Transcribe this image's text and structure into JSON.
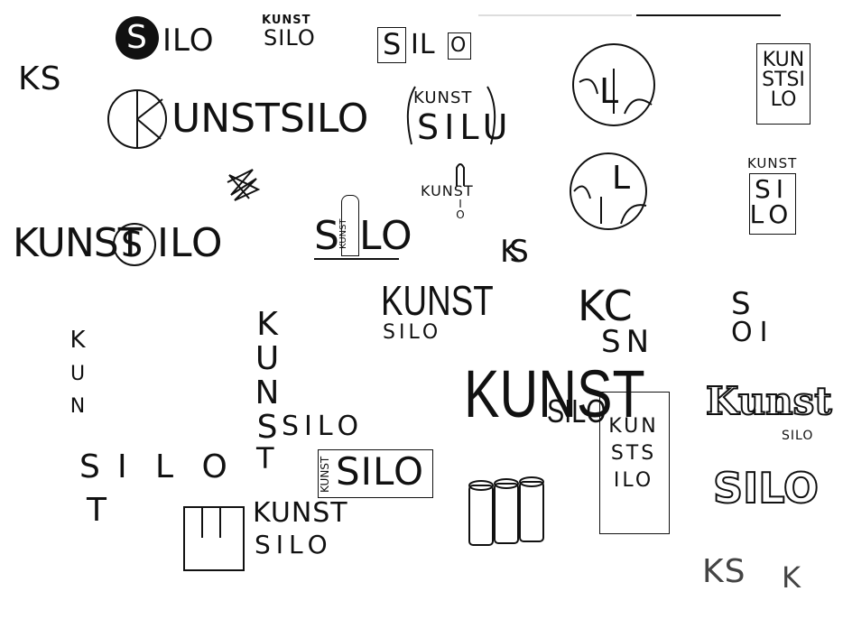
{
  "sketches": {
    "ks_top_left": "KS",
    "silo_black_circle": {
      "letter": "S",
      "rest": "ILO"
    },
    "kunst_silo_small": {
      "top": "KUNST",
      "bottom": "SILO"
    },
    "silo_boxes": {
      "s": "S",
      "il": "IL",
      "o": "O"
    },
    "circle_silo_1": {
      "letters": [
        "S",
        "I",
        "L",
        "O"
      ]
    },
    "kunstsilo_vertical_box_1": [
      "KUN",
      "STSI",
      "LO"
    ],
    "k_circle_kunstsilo": {
      "letter": "K",
      "rest": "UNSTSILO"
    },
    "kunst_silo_arc": {
      "top": "KUNST",
      "bottom": "SILU"
    },
    "kunst_small_stacked": {
      "top": "KUNST",
      "bottom": [
        "I",
        "O"
      ]
    },
    "circle_silo_2": {
      "letters": [
        "S",
        "I",
        "L",
        "O"
      ]
    },
    "kunst_silo_box_small": {
      "top": "KUNST",
      "rows": [
        "SI",
        "LO"
      ]
    },
    "kunstsilo_circle_s": {
      "left": "KUNST",
      "mid": "S",
      "right": "ILO"
    },
    "silo_kunst_in_i": {
      "s": "S",
      "kunst": "KUNST",
      "lo": "LO"
    },
    "ks_overlap": "KS",
    "kunst_silo_condensed": {
      "top": "KUNST",
      "bottom": "SILO"
    },
    "kc_sn": {
      "row1": "KC",
      "row2": "SN"
    },
    "s_lo_rotated": {
      "row1": "S",
      "row2": "OI"
    },
    "kunst_vertical_dashed": [
      "K",
      "U",
      "N",
      "S",
      "I",
      "T"
    ],
    "kunst_silo_vertical_horizontal": {
      "vertical": [
        "K",
        "U",
        "N",
        "S"
      ],
      "silo": "SILO",
      "t": "T"
    },
    "silo_big_cursive": "SILO",
    "kunst_silo_boxed": {
      "kunst": "KUNST",
      "silo": "SILO"
    },
    "kunstsilo_tall": {
      "kunst": "KUNST",
      "silo": "SILO"
    },
    "kunstsilo_tall_box": [
      "KUN",
      "STS",
      "ILO"
    ],
    "kunst_3d": {
      "top": "Kunst",
      "bottom": "SILO"
    },
    "silo_3d": "SILO",
    "kunst_silo_bottom": {
      "top": "KUNST",
      "bottom": "SILO"
    },
    "ks_bottom": "KS",
    "k_bottom": "K"
  }
}
